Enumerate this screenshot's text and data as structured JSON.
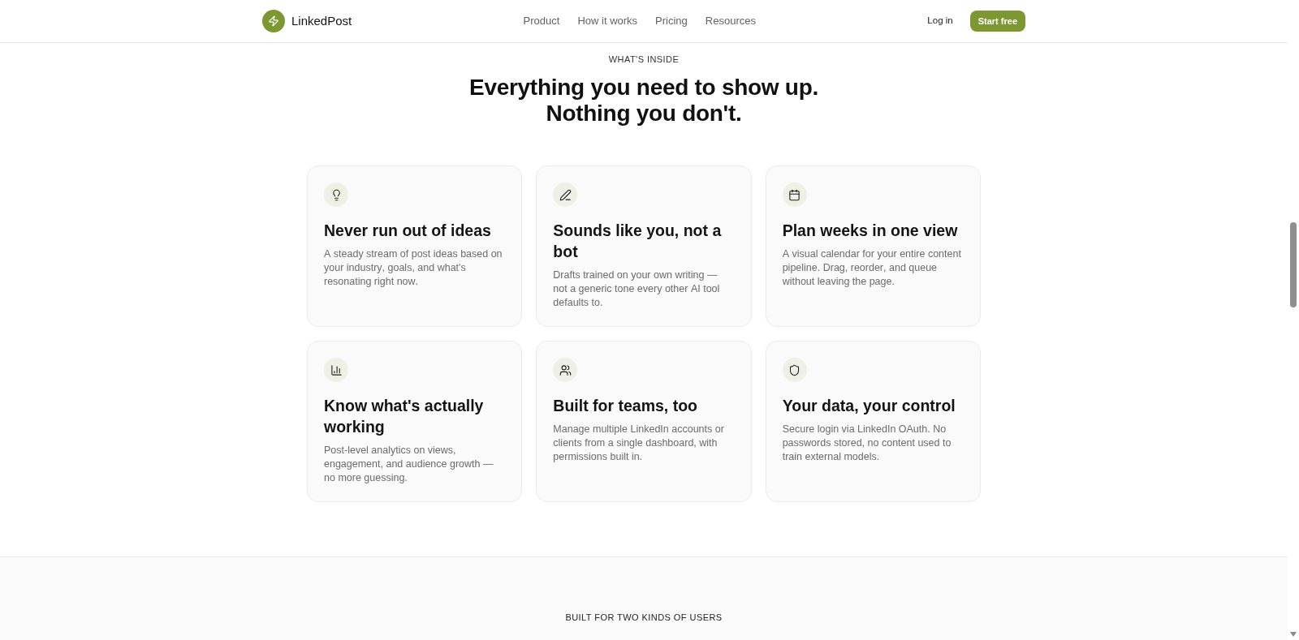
{
  "header": {
    "brand": "LinkedPost",
    "nav": [
      {
        "label": "Product"
      },
      {
        "label": "How it works"
      },
      {
        "label": "Pricing"
      },
      {
        "label": "Resources"
      }
    ],
    "login": "Log in",
    "cta": "Start free"
  },
  "features": {
    "eyebrow": "WHAT'S INSIDE",
    "heading": "Everything you need to show up. Nothing you don't.",
    "cards": [
      {
        "title": "Never run out of ideas",
        "description": "A steady stream of post ideas based on your industry, goals, and what's resonating right now."
      },
      {
        "title": "Sounds like you, not a bot",
        "description": "Drafts trained on your own writing — not a generic tone every other AI tool defaults to."
      },
      {
        "title": "Plan weeks in one view",
        "description": "A visual calendar for your entire content pipeline. Drag, reorder, and queue without leaving the page."
      },
      {
        "title": "Know what's actually working",
        "description": "Post-level analytics on views, engagement, and audience growth — no more guessing."
      },
      {
        "title": "Built for teams, too",
        "description": "Manage multiple LinkedIn accounts or clients from a single dashboard, with permissions built in."
      },
      {
        "title": "Your data, your control",
        "description": "Secure login via LinkedIn OAuth. No passwords stored, no content used to train external models."
      }
    ]
  },
  "audience": {
    "eyebrow": "BUILT FOR TWO KINDS OF USERS"
  }
}
